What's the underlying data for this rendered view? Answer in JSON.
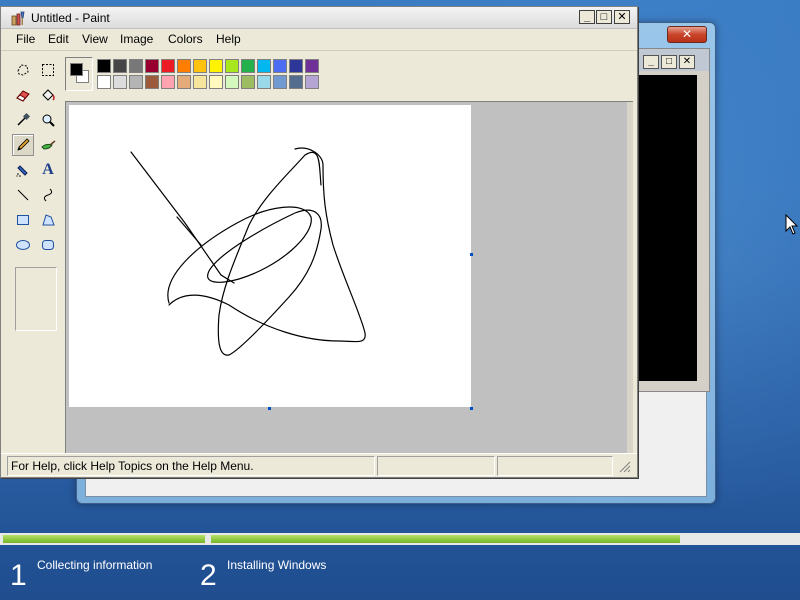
{
  "paint": {
    "title": "Untitled - Paint",
    "menu": [
      "File",
      "Edit",
      "View",
      "Image",
      "Colors",
      "Help"
    ],
    "tools": [
      {
        "name": "free-form-select-icon"
      },
      {
        "name": "rect-select-icon"
      },
      {
        "name": "eraser-icon"
      },
      {
        "name": "fill-bucket-icon"
      },
      {
        "name": "pick-color-icon"
      },
      {
        "name": "magnifier-icon"
      },
      {
        "name": "pencil-icon"
      },
      {
        "name": "brush-icon"
      },
      {
        "name": "airbrush-icon"
      },
      {
        "name": "text-icon"
      },
      {
        "name": "line-icon"
      },
      {
        "name": "curve-icon"
      },
      {
        "name": "rectangle-icon"
      },
      {
        "name": "polygon-icon"
      },
      {
        "name": "ellipse-icon"
      },
      {
        "name": "rounded-rect-icon"
      }
    ],
    "text_tool_glyph": "A",
    "active_tool": "pencil-icon",
    "colors": {
      "foreground": "#000000",
      "background": "#ffffff",
      "row1": [
        "#000000",
        "#464646",
        "#787878",
        "#990030",
        "#ed1c24",
        "#ff7e00",
        "#ffc20e",
        "#fff200",
        "#a8e61d",
        "#22b14c",
        "#00b7ef",
        "#4d6df3",
        "#2f3699",
        "#6f3198"
      ],
      "row2": [
        "#ffffff",
        "#dcdcdc",
        "#b4b4b4",
        "#9c5a3c",
        "#ffa3b1",
        "#e5aa7a",
        "#f5e49c",
        "#fff9bd",
        "#d3f9bc",
        "#9dbb61",
        "#99d9ea",
        "#709ad1",
        "#546d8e",
        "#b5a5d5"
      ]
    },
    "status": {
      "help_text": "For Help, click Help Topics on the Help Menu.",
      "coords": "",
      "size": ""
    }
  },
  "setup": {
    "close_glyph": "✕",
    "steps": [
      {
        "number": "1",
        "label": "Collecting information"
      },
      {
        "number": "2",
        "label": "Installing Windows"
      }
    ],
    "progress": {
      "completed_fraction": 0.8
    }
  },
  "window_buttons": {
    "minimize": "_",
    "maximize": "□",
    "close": "✕"
  }
}
